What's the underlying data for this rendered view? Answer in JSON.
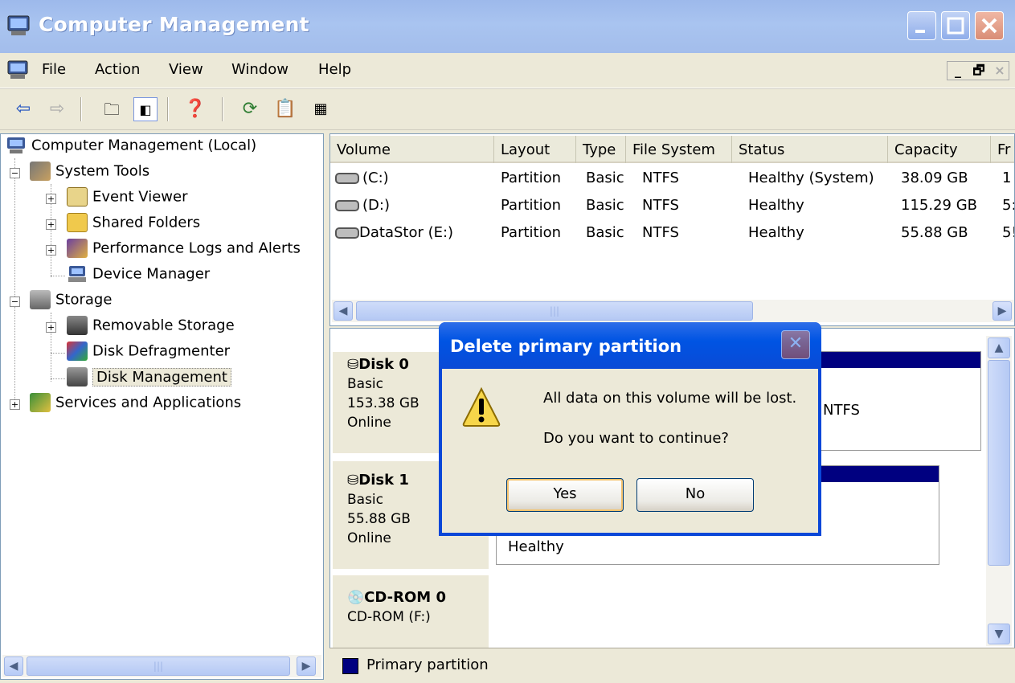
{
  "window": {
    "title": "Computer Management",
    "controls": [
      "minimize",
      "maximize",
      "close"
    ]
  },
  "menu": {
    "items": [
      "File",
      "Action",
      "View",
      "Window",
      "Help"
    ],
    "inner_controls": [
      "_",
      "🗗",
      "×"
    ]
  },
  "toolbar": {
    "tools": [
      "back-icon",
      "forward-icon",
      "up-one-level-icon",
      "show-hide-tree-icon",
      "help-icon",
      "refresh-icon",
      "properties-icon",
      "export-icon"
    ]
  },
  "tree": {
    "root": "Computer Management (Local)",
    "system_tools": "System Tools",
    "event_viewer": "Event Viewer",
    "shared_folders": "Shared Folders",
    "perf_logs": "Performance Logs and Alerts",
    "device_manager": "Device Manager",
    "storage": "Storage",
    "removable_storage": "Removable Storage",
    "disk_defrag": "Disk Defragmenter",
    "disk_management": "Disk Management",
    "services_apps": "Services and Applications"
  },
  "volumes": {
    "columns": [
      "Volume",
      "Layout",
      "Type",
      "File System",
      "Status",
      "Capacity",
      "Fr"
    ],
    "rows": [
      {
        "volume": "(C:)",
        "layout": "Partition",
        "type": "Basic",
        "fs": "NTFS",
        "status": "Healthy (System)",
        "capacity": "38.09 GB",
        "free": "1"
      },
      {
        "volume": "(D:)",
        "layout": "Partition",
        "type": "Basic",
        "fs": "NTFS",
        "status": "Healthy",
        "capacity": "115.29 GB",
        "free": "5:"
      },
      {
        "volume": "DataStor (E:)",
        "layout": "Partition",
        "type": "Basic",
        "fs": "NTFS",
        "status": "Healthy",
        "capacity": "55.88 GB",
        "free": "5!"
      }
    ]
  },
  "disks": {
    "disk0": {
      "name": "Disk 0",
      "kind": "Basic",
      "size": "153.38 GB",
      "state": "Online",
      "vol_text": "NTFS"
    },
    "disk1": {
      "name": "Disk 1",
      "kind": "Basic",
      "size": "55.88 GB",
      "state": "Online",
      "vol_text": "Healthy"
    },
    "cdrom": {
      "name": "CD-ROM 0",
      "label": "CD-ROM (F:)"
    }
  },
  "legend": {
    "primary": "Primary partition",
    "primary_color": "#000080"
  },
  "dialog": {
    "title": "Delete primary partition",
    "message1": "All data on this volume will be lost.",
    "message2": "Do you want to continue?",
    "yes": "Yes",
    "no": "No"
  }
}
